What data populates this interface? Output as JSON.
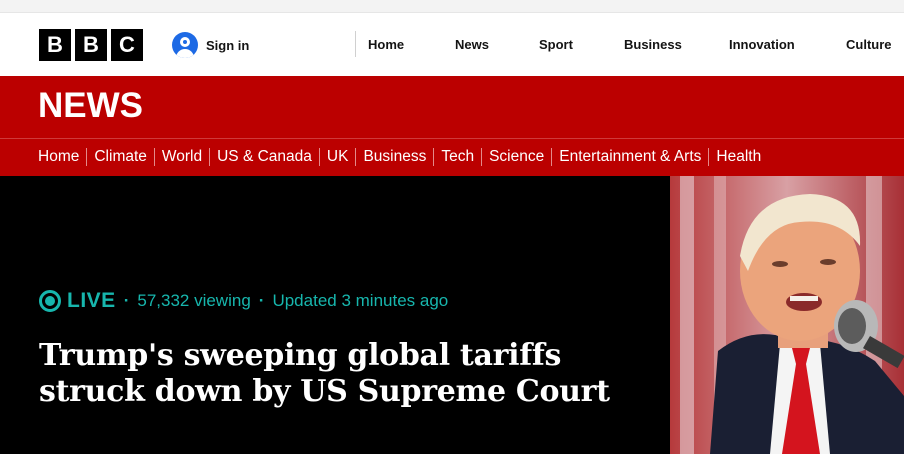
{
  "brand": {
    "letters": [
      "B",
      "B",
      "C"
    ]
  },
  "signin": {
    "label": "Sign in"
  },
  "topnav": [
    "Home",
    "News",
    "Sport",
    "Business",
    "Innovation",
    "Culture"
  ],
  "section": {
    "title": "NEWS"
  },
  "secnav": [
    "Home",
    "Climate",
    "World",
    "US & Canada",
    "UK",
    "Business",
    "Tech",
    "Science",
    "Entertainment & Arts",
    "Health"
  ],
  "hero": {
    "live_label": "LIVE",
    "viewing": "57,332 viewing",
    "updated": "Updated 3 minutes ago",
    "headline": "Trump's sweeping global tariffs struck down by US Supreme Court"
  },
  "colors": {
    "bbc_red": "#bb0000",
    "live_teal": "#17b6ad",
    "signin_blue": "#1d6ae5"
  },
  "icons": {
    "signin": "user-avatar-icon",
    "live": "live-indicator-icon"
  }
}
